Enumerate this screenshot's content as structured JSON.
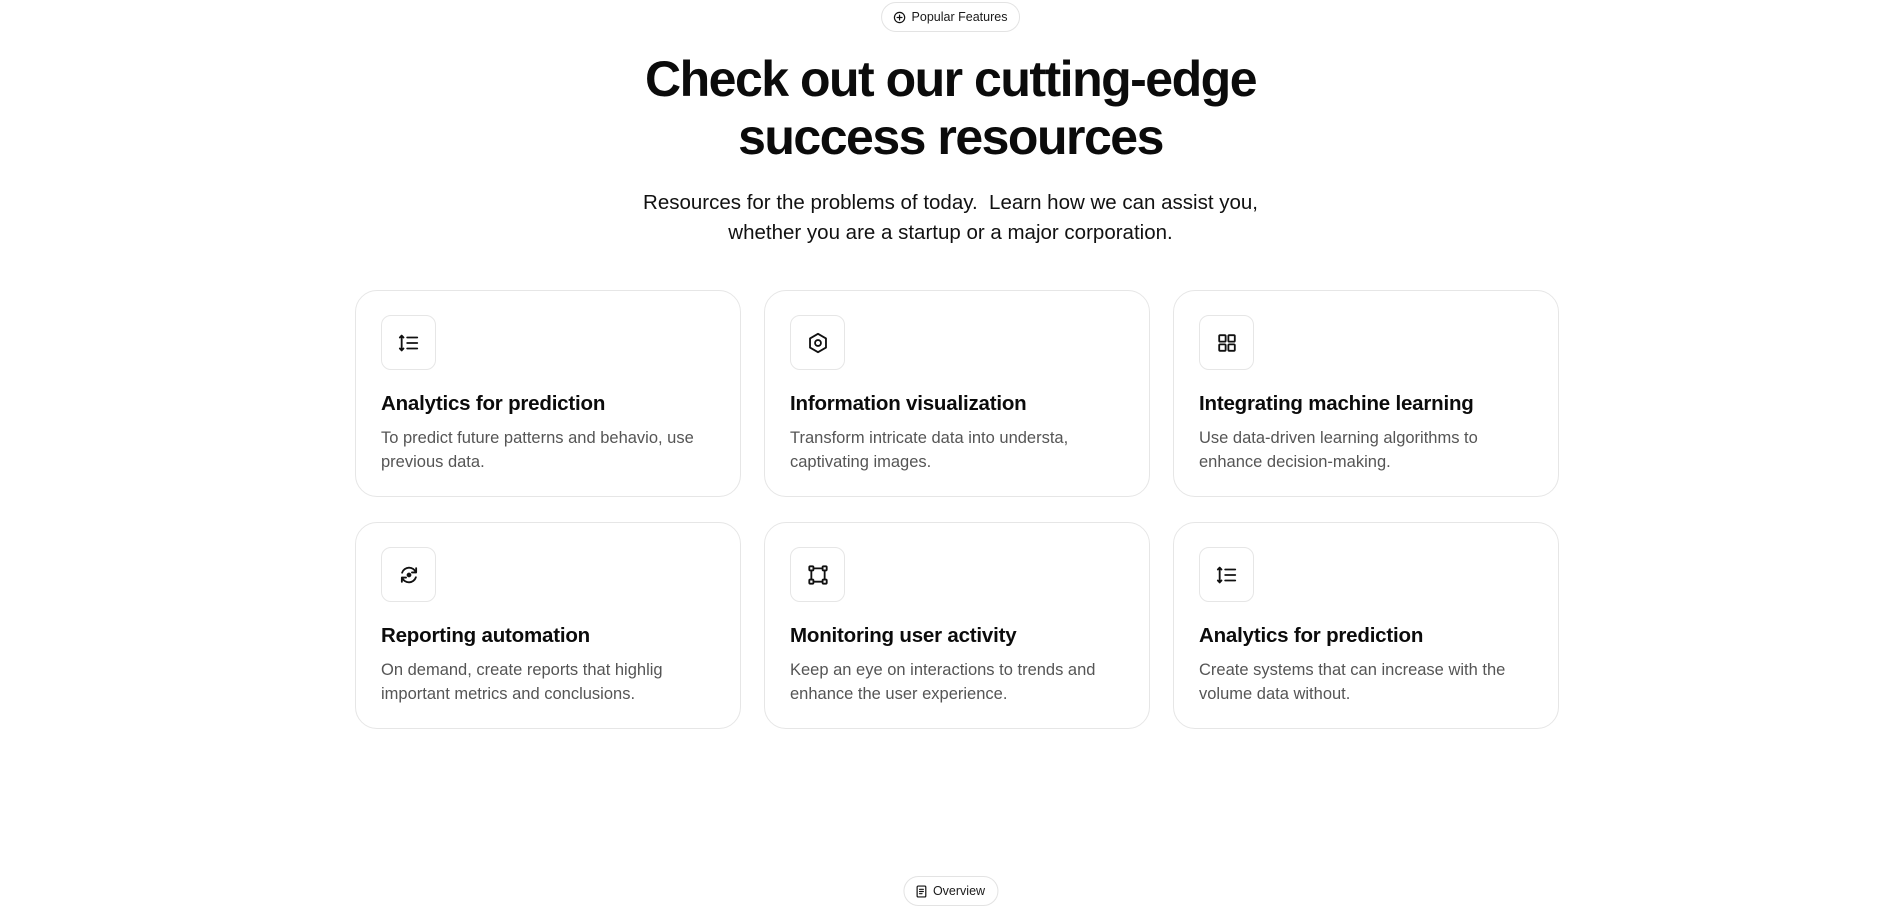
{
  "badge_top": {
    "label": "Popular Features",
    "icon": "plus-circle-icon"
  },
  "header": {
    "title_line1": "Check out our cutting-edge",
    "title_line2": "success resources",
    "subtitle_line1": "Resources for the problems of today.  Learn how we can assist you,",
    "subtitle_line2": "whether you are a startup or a major corporation."
  },
  "features": [
    {
      "icon": "list-ordered-icon",
      "title": "Analytics for prediction",
      "description": "To predict future patterns and behavio, use previous data."
    },
    {
      "icon": "hexagon-icon",
      "title": "Information visualization",
      "description": "Transform intricate data into understa, captivating images."
    },
    {
      "icon": "grid-icon",
      "title": "Integrating machine learning",
      "description": "Use data-driven learning algorithms to enhance decision-making."
    },
    {
      "icon": "refresh-circle-icon",
      "title": "Reporting automation",
      "description": "On demand, create reports that highlig important metrics and conclusions."
    },
    {
      "icon": "bounding-box-icon",
      "title": "Monitoring user activity",
      "description": "Keep an eye on interactions to trends and enhance the user experience."
    },
    {
      "icon": "list-ordered-icon",
      "title": "Analytics for prediction",
      "description": "Create systems that can increase with the volume data without."
    }
  ],
  "badge_bottom": {
    "label": "Overview",
    "icon": "document-icon"
  }
}
